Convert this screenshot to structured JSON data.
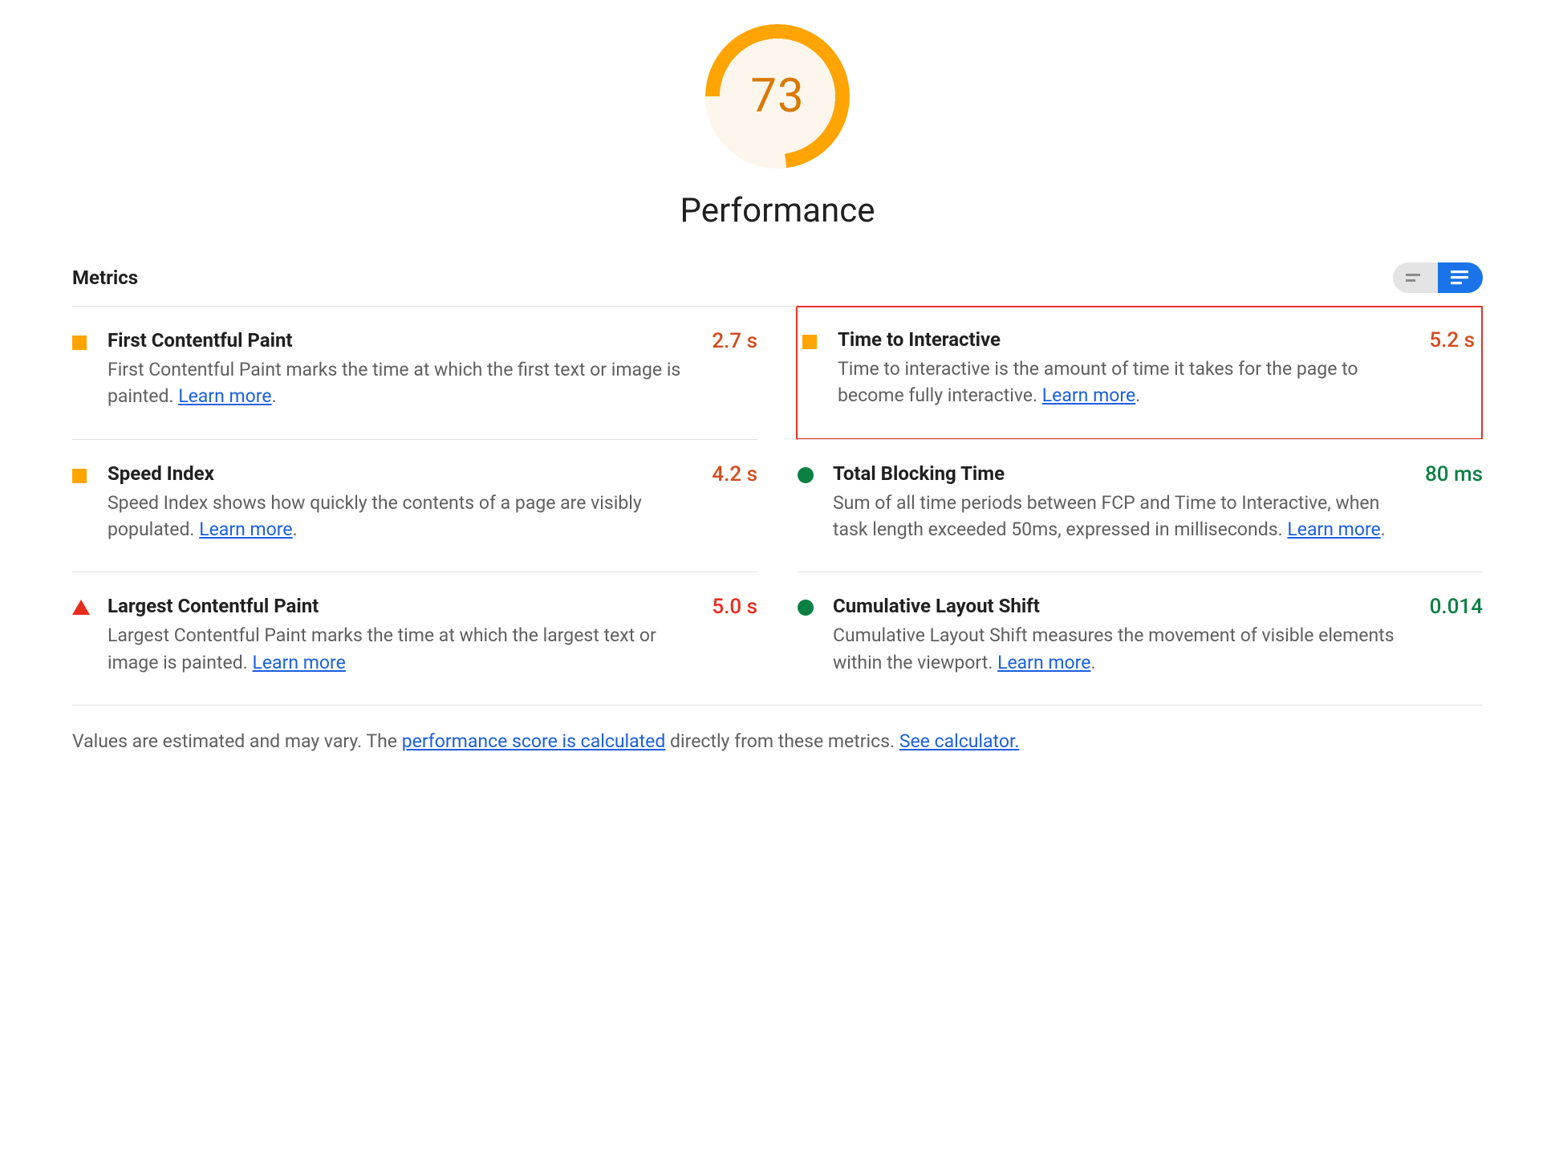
{
  "gauge": {
    "score": "73",
    "title": "Performance"
  },
  "metrics_heading": "Metrics",
  "learn_more_label": "Learn more",
  "metrics": {
    "fcp": {
      "name": "First Contentful Paint",
      "desc": "First Contentful Paint marks the time at which the first text or image is painted.",
      "value": "2.7 s",
      "status": "orange"
    },
    "tti": {
      "name": "Time to Interactive",
      "desc": "Time to interactive is the amount of time it takes for the page to become fully interactive.",
      "value": "5.2 s",
      "status": "orange"
    },
    "si": {
      "name": "Speed Index",
      "desc": "Speed Index shows how quickly the contents of a page are visibly populated.",
      "value": "4.2 s",
      "status": "orange"
    },
    "tbt": {
      "name": "Total Blocking Time",
      "desc": "Sum of all time periods between FCP and Time to Interactive, when task length exceeded 50ms, expressed in milliseconds.",
      "value": "80 ms",
      "status": "green"
    },
    "lcp": {
      "name": "Largest Contentful Paint",
      "desc": "Largest Contentful Paint marks the time at which the largest text or image is painted.",
      "value": "5.0 s",
      "status": "red"
    },
    "cls": {
      "name": "Cumulative Layout Shift",
      "desc": "Cumulative Layout Shift measures the movement of visible elements within the viewport.",
      "value": "0.014",
      "status": "green"
    }
  },
  "footnote": {
    "prefix": "Values are estimated and may vary. The ",
    "link1": "performance score is calculated",
    "mid": " directly from these metrics. ",
    "link2": "See calculator."
  }
}
